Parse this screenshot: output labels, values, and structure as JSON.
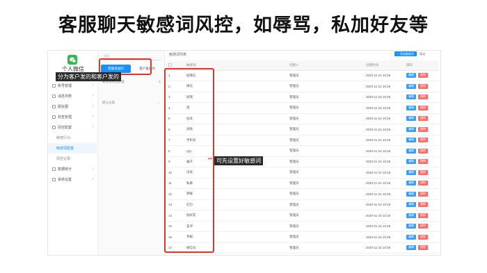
{
  "headline": "客服聊天敏感词风控，如辱骂，私加好友等",
  "sidebar": {
    "brand": "个人微信",
    "items": [
      {
        "label": "账号管理",
        "sub": false
      },
      {
        "label": "消息列表",
        "sub": false
      },
      {
        "label": "朋友圈",
        "sub": false
      },
      {
        "label": "标签管理",
        "sub": false
      },
      {
        "label": "风控配置",
        "sub": false
      },
      {
        "label": "敏感行为",
        "sub": true
      },
      {
        "label": "敏感词配置",
        "sub": true,
        "active": true
      },
      {
        "label": "风控记录",
        "sub": true
      },
      {
        "label": "数据统计",
        "sub": false
      },
      {
        "label": "系统设置",
        "sub": false
      }
    ]
  },
  "column2": {
    "search_placeholder": "搜索",
    "tabs": [
      "客服发送的",
      "客户发送的"
    ],
    "rows": [
      {
        "label": "敏感词分类管理",
        "meta": "1"
      },
      {
        "label": "默认分类",
        "meta": "…"
      }
    ]
  },
  "main": {
    "title": "敏感词列表",
    "add_label": "+ 添加敏感词",
    "export_label": "导出",
    "columns": [
      "",
      "敏感词",
      "创建人",
      "创建时间",
      "操作"
    ],
    "edit_label": "编辑",
    "delete_label": "删除",
    "rows": [
      {
        "id": "1",
        "word": "加微信",
        "creator": "管理员",
        "time": "2020-11-24 10:26"
      },
      {
        "id": "2",
        "word": "微信",
        "creator": "管理员",
        "time": "2020-11-24 10:26"
      },
      {
        "id": "3",
        "word": "加我",
        "creator": "管理员",
        "time": "2020-11-24 10:26"
      },
      {
        "id": "4",
        "word": "滚",
        "creator": "管理员",
        "time": "2020-11-24 10:26"
      },
      {
        "id": "5",
        "word": "投诉",
        "creator": "管理员",
        "time": "2020-11-24 10:26"
      },
      {
        "id": "6",
        "word": "退款",
        "creator": "管理员",
        "time": "2020-11-24 10:26"
      },
      {
        "id": "7",
        "word": "手机号",
        "creator": "管理员",
        "time": "2020-11-24 10:26"
      },
      {
        "id": "8",
        "word": "QQ",
        "creator": "管理员",
        "time": "2020-11-24 10:26"
      },
      {
        "id": "9",
        "word": "骗子",
        "creator": "管理员",
        "time": "2020-11-24 10:26"
      },
      {
        "id": "10",
        "word": "垃圾",
        "creator": "管理员",
        "time": "2020-11-24 10:26"
      },
      {
        "id": "11",
        "word": "私聊",
        "creator": "管理员",
        "time": "2020-11-24 10:26"
      },
      {
        "id": "12",
        "word": "转账",
        "creator": "管理员",
        "time": "2020-11-24 10:26"
      },
      {
        "id": "13",
        "word": "红包",
        "creator": "管理员",
        "time": "2020-11-24 10:26"
      },
      {
        "id": "14",
        "word": "加好友",
        "creator": "管理员",
        "time": "2020-11-24 10:26"
      },
      {
        "id": "15",
        "word": "差评",
        "creator": "管理员",
        "time": "2020-11-24 10:26"
      },
      {
        "id": "16",
        "word": "举报",
        "creator": "管理员",
        "time": "2020-11-24 10:26"
      },
      {
        "id": "17",
        "word": "微信号",
        "creator": "管理员",
        "time": "2020-11-24 10:26"
      }
    ]
  },
  "callouts": {
    "tabs_note": "分为客户发的和客户发的",
    "words_note": "可先设置好敏感词"
  },
  "colors": {
    "accent": "#1890ff",
    "highlight": "#e0352b",
    "logo": "#2dbb4f"
  }
}
